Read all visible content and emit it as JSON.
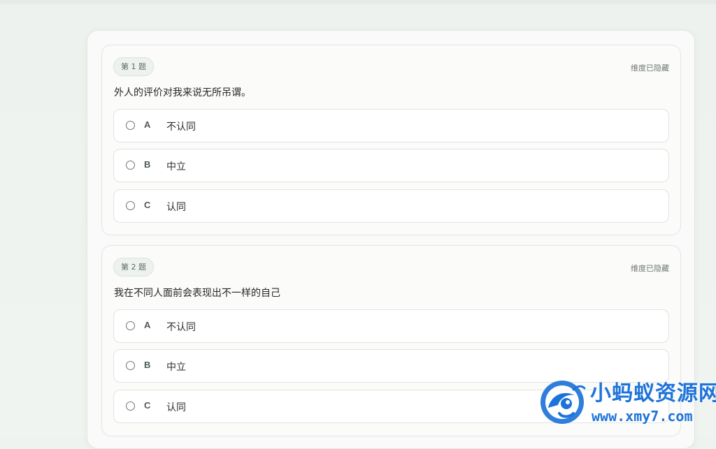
{
  "questions": [
    {
      "badge": "第 1 题",
      "hint": "维度已隐藏",
      "text": "外人的评价对我来说无所吊谓。",
      "options": [
        {
          "letter": "A",
          "label": "不认同"
        },
        {
          "letter": "B",
          "label": "中立"
        },
        {
          "letter": "C",
          "label": "认同"
        }
      ]
    },
    {
      "badge": "第 2 题",
      "hint": "维度已隐藏",
      "text": "我在不同人面前会表现出不一样的自己",
      "options": [
        {
          "letter": "A",
          "label": "不认同"
        },
        {
          "letter": "B",
          "label": "中立"
        },
        {
          "letter": "C",
          "label": "认同"
        }
      ]
    }
  ],
  "watermark": {
    "title": "小蚂蚁资源网",
    "url": "www.xmy7.com"
  },
  "colors": {
    "background": "#eef3ef",
    "card": "#fbfbfa",
    "border": "#e1e6e2",
    "watermark": "#1e73d8"
  }
}
